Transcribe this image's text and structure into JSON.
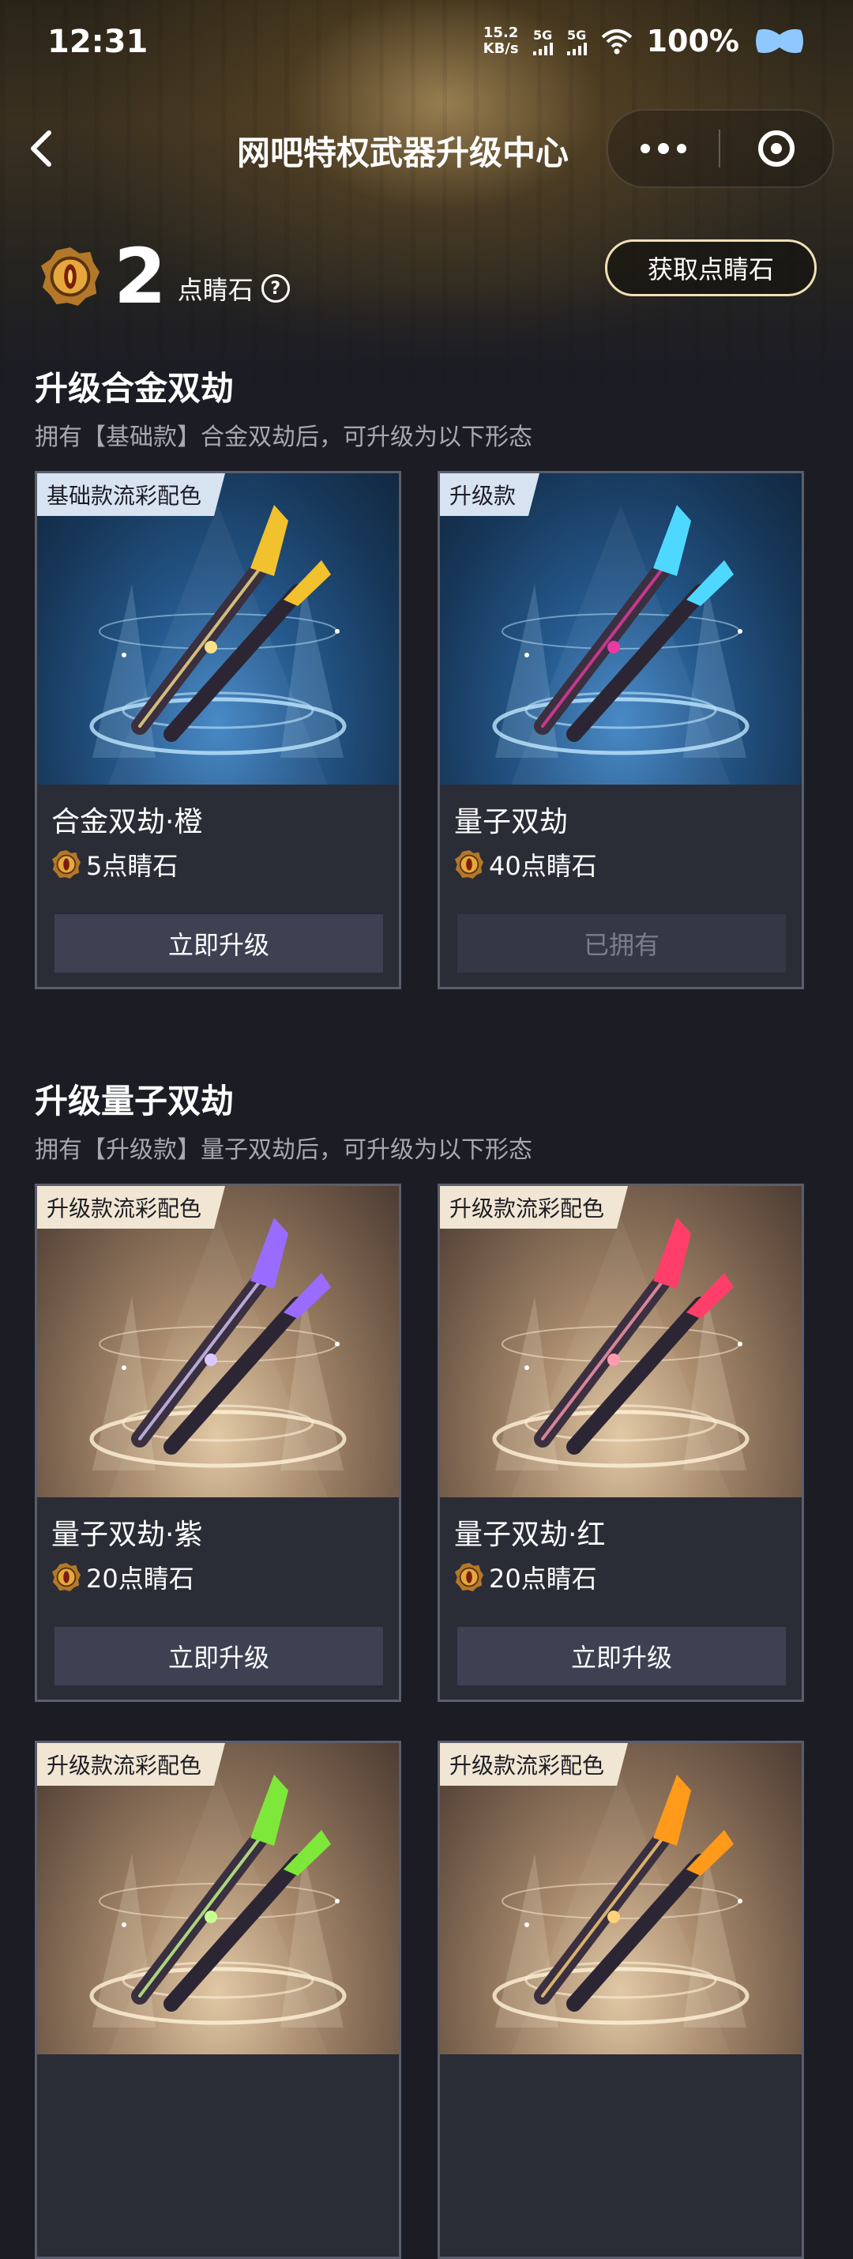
{
  "status": {
    "time": "12:31",
    "speed_value": "15.2",
    "speed_unit": "KB/s",
    "net1": "5G",
    "net2": "5G",
    "battery": "100%"
  },
  "nav": {
    "title": "网吧特权武器升级中心"
  },
  "points": {
    "value": "2",
    "unit": "点睛石",
    "help": "?",
    "get_label": "获取点睛石"
  },
  "sections": [
    {
      "title": "升级合金双劫",
      "subtitle": "拥有【基础款】合金双劫后，可升级为以下形态"
    },
    {
      "title": "升级量子双劫",
      "subtitle": "拥有【升级款】量子双劫后，可升级为以下形态"
    }
  ],
  "cards": [
    {
      "tag": "基础款流彩配色",
      "name": "合金双劫·橙",
      "price": "5点睛石",
      "button": "立即升级",
      "theme": "blue",
      "blade": "#f2c12e",
      "accent": "#f7e08a"
    },
    {
      "tag": "升级款",
      "name": "量子双劫",
      "price": "40点睛石",
      "button": "已拥有",
      "theme": "blue",
      "blade": "#4fd8ff",
      "accent": "#e83aa0"
    },
    {
      "tag": "升级款流彩配色",
      "name": "量子双劫·紫",
      "price": "20点睛石",
      "button": "立即升级",
      "theme": "gold",
      "blade": "#9a6bff",
      "accent": "#d9c8ff"
    },
    {
      "tag": "升级款流彩配色",
      "name": "量子双劫·红",
      "price": "20点睛石",
      "button": "立即升级",
      "theme": "gold",
      "blade": "#ff3f6a",
      "accent": "#ff9ab0"
    },
    {
      "tag": "升级款流彩配色",
      "theme": "gold",
      "blade": "#7ee83a",
      "accent": "#c9ff90"
    },
    {
      "tag": "升级款流彩配色",
      "theme": "gold",
      "blade": "#ff9a1a",
      "accent": "#ffd27a"
    }
  ]
}
